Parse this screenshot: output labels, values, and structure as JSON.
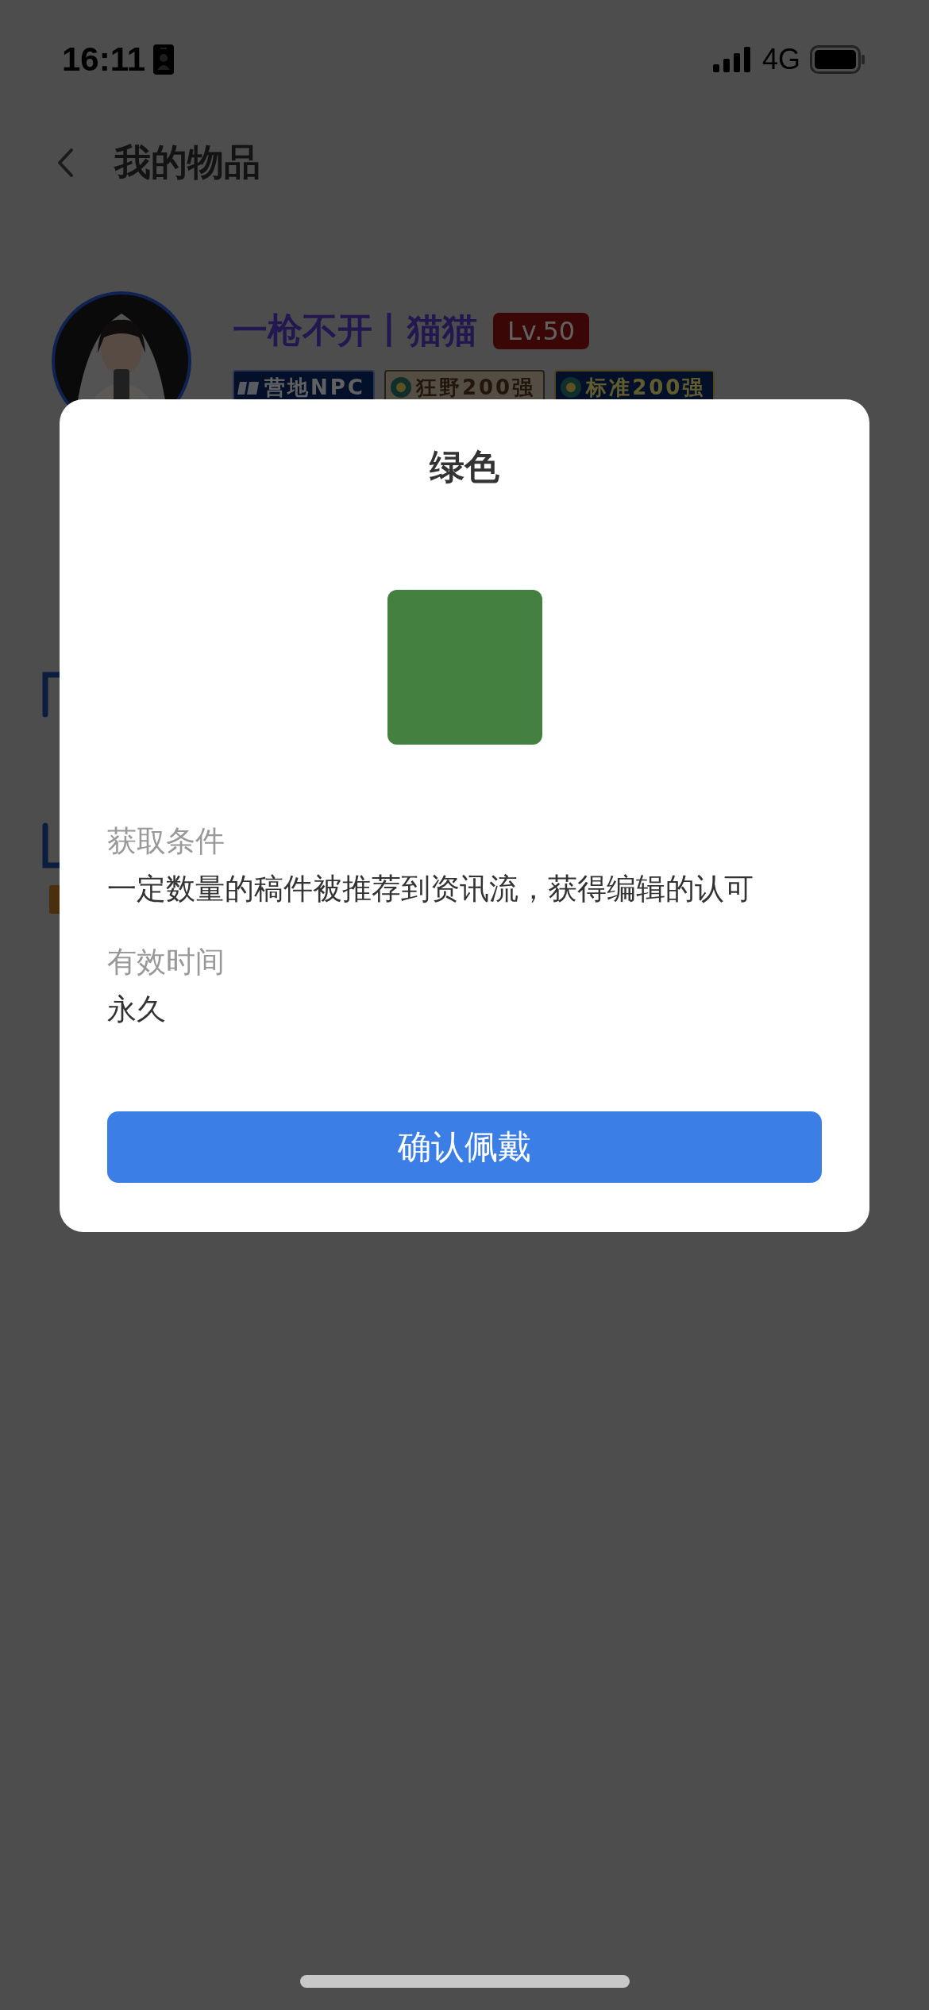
{
  "status_bar": {
    "time": "16:11",
    "network": "4G"
  },
  "header": {
    "title": "我的物品"
  },
  "profile": {
    "name": "一枪不开丨猫猫",
    "level": "Lv.50",
    "badges": [
      {
        "label": "营地NPC",
        "kind": "camp"
      },
      {
        "label": "狂野200强",
        "kind": "wild"
      },
      {
        "label": "标准200强",
        "kind": "standard"
      }
    ]
  },
  "dialog": {
    "title": "绿色",
    "sections": [
      {
        "label": "获取条件",
        "value": "一定数量的稿件被推荐到资讯流，获得编辑的认可"
      },
      {
        "label": "有效时间",
        "value": "永久"
      }
    ],
    "button": "确认佩戴"
  }
}
